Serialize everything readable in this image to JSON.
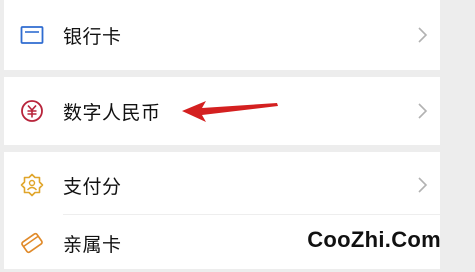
{
  "menu": {
    "items": [
      {
        "label": "银行卡",
        "icon": "bank-card-icon"
      },
      {
        "label": "数字人民币",
        "icon": "digital-rmb-icon"
      },
      {
        "label": "支付分",
        "icon": "payment-score-icon"
      },
      {
        "label": "亲属卡",
        "icon": "family-card-icon"
      }
    ]
  },
  "annotation": {
    "arrow_color": "#d42020"
  },
  "watermark": "CooZhi.Com",
  "colors": {
    "page_bg": "#ededed",
    "row_bg": "#ffffff",
    "text": "#111111",
    "chevron": "#b2b2b2"
  }
}
